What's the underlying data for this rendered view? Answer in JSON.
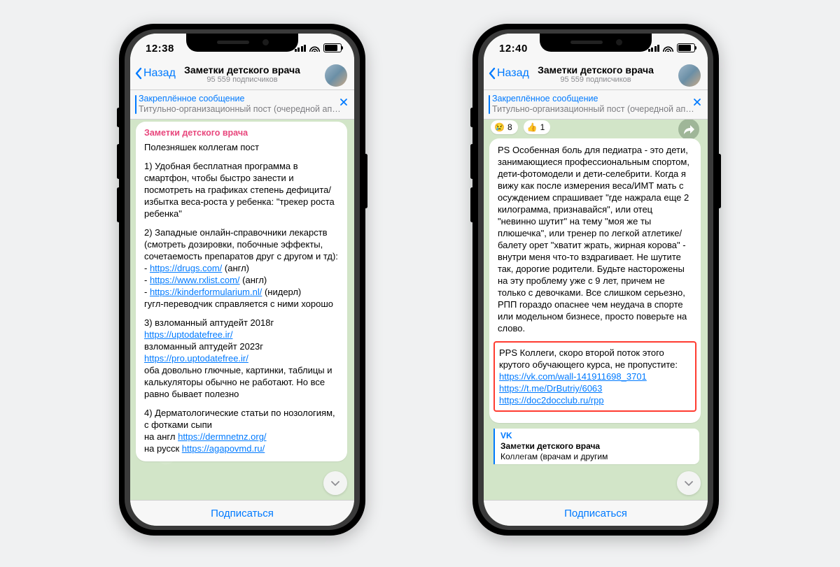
{
  "phones": {
    "left": {
      "statusbar": {
        "time": "12:38"
      },
      "header": {
        "back": "Назад",
        "title": "Заметки детского врача",
        "subtitle": "95 559 подписчиков"
      },
      "pinned": {
        "title": "Закреплённое сообщение",
        "text": "Титульно-организационный пост (очередной ап…"
      },
      "message": {
        "channel": "Заметки детского врача",
        "intro": "Полезняшек коллегам пост",
        "p1": "1) Удобная бесплатная программа в смартфон, чтобы быстро занести и посмотреть на графиках степень дефицита/избытка веса-роста у ребенка: \"трекер роста ребенка\"",
        "p2_lead": "2) Западные онлайн-справочники лекарств (смотреть дозировки, побочные эффекты, сочетаемость препаратов друг с другом и тд):",
        "p2_l1_pre": "- ",
        "p2_l1_link": "https://drugs.com/",
        "p2_l1_suf": " (англ)",
        "p2_l2_pre": "- ",
        "p2_l2_link": "https://www.rxlist.com/",
        "p2_l2_suf": " (англ)",
        "p2_l3_pre": "- ",
        "p2_l3_link": "https://kinderformularium.nl/",
        "p2_l3_suf": " (нидерл)",
        "p2_tail": "гугл-переводчик справляется с ними хорошо",
        "p3_a": "3) взломанный аптудейт 2018г ",
        "p3_a_link": "https://uptodatefree.ir/",
        "p3_b": "взломанный аптудейт 2023г ",
        "p3_b_link": "https://pro.uptodatefree.ir/",
        "p3_tail": "оба довольно глючные, картинки, таблицы и калькуляторы обычно не работают. Но все равно бывает полезно",
        "p4_a": "4) Дерматологические статьи по нозологиям, с фотками сыпи",
        "p4_b_pre": "на англ ",
        "p4_b_link": "https://dermnetnz.org/",
        "p4_c_pre": "на русск ",
        "p4_c_link": "https://agapovmd.ru/"
      },
      "subscribe": "Подписаться"
    },
    "right": {
      "statusbar": {
        "time": "12:40"
      },
      "header": {
        "back": "Назад",
        "title": "Заметки детского врача",
        "subtitle": "95 559 подписчиков"
      },
      "pinned": {
        "title": "Закреплённое сообщение",
        "text": "Титульно-организационный пост (очередной ап…"
      },
      "reactions": {
        "r1_emoji": "😢",
        "r1_count": "8",
        "r2_emoji": "👍",
        "r2_count": "1"
      },
      "message": {
        "ps": "PS Особенная боль для педиатра - это дети, занимающиеся профессиональным спортом, дети-фотомодели и дети-селебрити. Когда я вижу как после измерения веса/ИМТ мать с осуждением спрашивает \"где нажрала еще 2 килограмма, признавайся\", или отец \"невинно шутит\" на тему \"моя же ты плюшечка\", или тренер по легкой атлетике/балету орет \"хватит жрать, жирная корова\" - внутри меня что-то вздрагивает. Не шутите так, дорогие родители. Будьте насторожены на эту проблему уже с 9 лет, причем не только с девочками. Все слишком серьезно, РПП гораздо опаснее чем неудача в спорте или модельном бизнесе, просто поверьте на слово.",
        "pps_lead": "PPS Коллеги, скоро второй поток этого крутого обучающего курса, не пропустите:",
        "pps_link1": "https://vk.com/wall-141911698_3701",
        "pps_link2": "https://t.me/DrButriy/6063",
        "pps_link3": "https://doc2docclub.ru/rpp"
      },
      "preview": {
        "site": "VK",
        "title": "Заметки детского врача",
        "desc": "Коллегам (врачам и другим"
      },
      "subscribe": "Подписаться"
    }
  }
}
